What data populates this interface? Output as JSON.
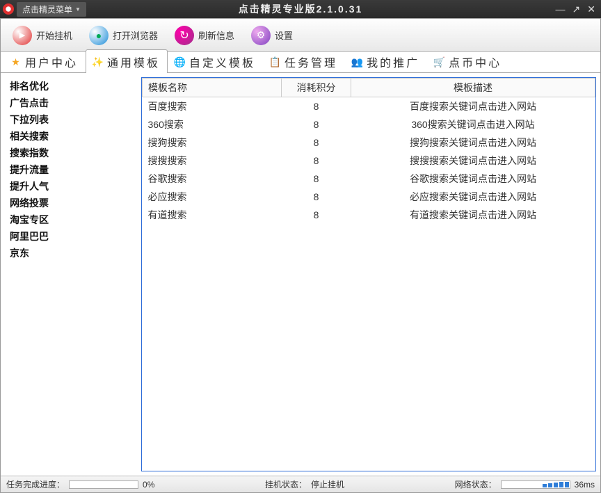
{
  "titlebar": {
    "menu_label": "点击精灵菜单",
    "title": "点击精灵专业版2.1.0.31"
  },
  "toolbar": {
    "start": "开始挂机",
    "browser": "打开浏览器",
    "refresh": "刷新信息",
    "settings": "设置"
  },
  "tabs": {
    "user_center": "用户中心",
    "general_template": "通用模板",
    "custom_template": "自定义模板",
    "task_manage": "任务管理",
    "my_promo": "我的推广",
    "coin_center": "点币中心"
  },
  "sidebar": {
    "items": [
      "排名优化",
      "广告点击",
      "下拉列表",
      "相关搜索",
      "搜索指数",
      "提升流量",
      "提升人气",
      "网络投票",
      "淘宝专区",
      "阿里巴巴",
      "京东"
    ]
  },
  "table": {
    "headers": {
      "name": "模板名称",
      "cost": "消耗积分",
      "desc": "模板描述"
    },
    "rows": [
      {
        "name": "百度搜索",
        "cost": "8",
        "desc": "百度搜索关键词点击进入网站"
      },
      {
        "name": "360搜索",
        "cost": "8",
        "desc": "360搜索关键词点击进入网站"
      },
      {
        "name": "搜狗搜索",
        "cost": "8",
        "desc": "搜狗搜索关键词点击进入网站"
      },
      {
        "name": "搜搜搜索",
        "cost": "8",
        "desc": "搜搜搜索关键词点击进入网站"
      },
      {
        "name": "谷歌搜索",
        "cost": "8",
        "desc": "谷歌搜索关键词点击进入网站"
      },
      {
        "name": "必应搜索",
        "cost": "8",
        "desc": "必应搜索关键词点击进入网站"
      },
      {
        "name": "有道搜索",
        "cost": "8",
        "desc": "有道搜索关键词点击进入网站"
      }
    ]
  },
  "statusbar": {
    "task_progress_label": "任务完成进度：",
    "task_progress_value": "0%",
    "hang_status_label": "挂机状态：",
    "hang_status_value": "停止挂机",
    "net_status_label": "网络状态：",
    "net_latency": "36ms"
  }
}
